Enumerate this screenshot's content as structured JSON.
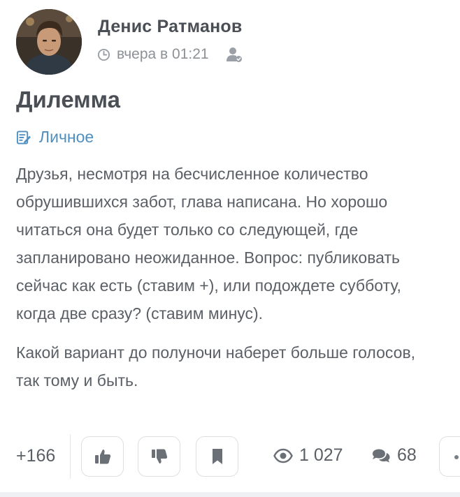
{
  "author": {
    "name": "Денис Ратманов",
    "time": "вчера в 01:21"
  },
  "post": {
    "title": "Дилемма",
    "category": "Личное",
    "paragraphs": [
      [
        "Друзья, несмотря на бесчисленное количество",
        "обрушившихся забот, глава написана. Но хорошо",
        "читаться она будет только со следующей, где",
        "запланировано неожиданное. Вопрос: публиковать",
        "сейчас как есть (ставим +), или подождете субботу,",
        "когда две сразу? (ставим минус)."
      ],
      [
        "Какой вариант до полуночи наберет больше голосов,",
        "так тому и быть."
      ]
    ]
  },
  "actions": {
    "rating": "+166",
    "views": "1 027",
    "comments": "68"
  },
  "icons": {
    "clock": "clock-icon",
    "author": "user-check-icon",
    "category": "edit-note-icon",
    "like": "thumbs-up-icon",
    "dislike": "thumbs-down-icon",
    "bookmark": "bookmark-icon",
    "views": "eye-icon",
    "comments": "comments-icon",
    "more": "more-icon"
  },
  "colors": {
    "accent": "#4f8fc0",
    "text": "#5b6066",
    "muted": "#8d9196",
    "border": "#dde0e3"
  }
}
